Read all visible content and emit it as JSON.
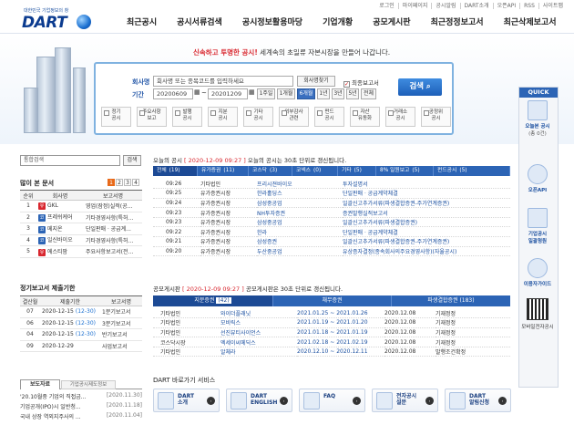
{
  "util": [
    "로그인",
    "마이페이지",
    "공시알림",
    "DART소개",
    "오픈API",
    "RSS",
    "사이트맵"
  ],
  "logo": {
    "sub": "대한민국 기업정보의 창",
    "word": "DART"
  },
  "gnb": [
    "최근공시",
    "공시서류검색",
    "공시정보활용마당",
    "기업개황",
    "공모게시판",
    "최근정정보고서",
    "최근삭제보고서"
  ],
  "hero": {
    "tag_bold": "신속하고 투명한 공시!",
    "tag_rest": " 세계속의 초일류 자본시장을 만들어 나갑니다."
  },
  "search": {
    "company_label": "회사명",
    "company_placeholder": "회사명 또는 종목코드를 입력하세요",
    "company_btn": "회사명찾기",
    "lastreport_label": "최종보고서",
    "period_label": "기간",
    "date_from": "20200609",
    "date_to": "20201209",
    "periods": [
      "1주일",
      "1개월",
      "6개월",
      "1년",
      "3년",
      "5년",
      "전체"
    ],
    "period_selected": "6개월",
    "search_btn": "검색",
    "categories": [
      [
        "정기",
        "공시"
      ],
      [
        "주요사항",
        "보고"
      ],
      [
        "발행",
        "공시"
      ],
      [
        "지분",
        "공시"
      ],
      [
        "기타",
        "공시"
      ],
      [
        "외부감사",
        "관련"
      ],
      [
        "펀드",
        "공시"
      ],
      [
        "자산",
        "유동화"
      ],
      [
        "거래소",
        "공시"
      ],
      [
        "공정위",
        "공시"
      ]
    ]
  },
  "quick": {
    "title": "QUICK",
    "items": [
      [
        "오늘본 공시",
        "(총 0건)"
      ],
      [
        "오픈API"
      ],
      [
        "기업공시",
        "일괄청원"
      ],
      [
        "이용자가이드"
      ],
      [
        "모바일전자공시"
      ]
    ]
  },
  "left": {
    "search_placeholder": "통합검색",
    "search_btn": "검색",
    "top_docs_title": "많이 본 문서",
    "pages": [
      "1",
      "2",
      "3",
      "4"
    ],
    "top_headers": [
      "순위",
      "회사명",
      "보고서명"
    ],
    "top_rows": [
      {
        "rank": "1",
        "badge": "유",
        "badge_color": "#d8262e",
        "company": "GKL",
        "report": "영업(잠정)실적(공..."
      },
      {
        "rank": "2",
        "badge": "코",
        "badge_color": "#2c64b5",
        "company": "프레쉬케어",
        "report": "기타경영사항(특허..."
      },
      {
        "rank": "3",
        "badge": "코",
        "badge_color": "#2c64b5",
        "company": "메지온",
        "report": "단일판매ㆍ공급계..."
      },
      {
        "rank": "4",
        "badge": "코",
        "badge_color": "#2c64b5",
        "company": "일신바이오",
        "report": "기타경영사항(특허..."
      },
      {
        "rank": "5",
        "badge": "유",
        "badge_color": "#d8262e",
        "company": "에스티팜",
        "report": "주요사항보고서(전..."
      }
    ],
    "period_title": "정기보고서 제출기한",
    "period_headers": [
      "결산월",
      "제출기한",
      "보고서명"
    ],
    "period_rows": [
      {
        "m": "07",
        "deadline": "2020-12-15",
        "tail": "(12-30)",
        "report": "1분기보고서"
      },
      {
        "m": "06",
        "deadline": "2020-12-15",
        "tail": "(12-30)",
        "report": "3분기보고서"
      },
      {
        "m": "04",
        "deadline": "2020-12-15",
        "tail": "(12-30)",
        "report": "반기보고서"
      },
      {
        "m": "09",
        "deadline": "2020-12-29",
        "tail": "",
        "report": "사업보고서"
      }
    ],
    "bottom_tabs": [
      "보도자료",
      "기업공시제도정보"
    ],
    "press": [
      {
        "t": "'20.10월중 기업의 직접금...",
        "d": "[2020.11.30]"
      },
      {
        "t": "기업공개(IPO)시 일반청...",
        "d": "[2020.11.18]"
      },
      {
        "t": "국내 상장 역외지주사의 ...",
        "d": "[2020.11.04]"
      }
    ]
  },
  "today": {
    "title_a": "오늘의 공시",
    "date": "[ 2020-12-09 09:27 ]",
    "title_b": "오늘의 공시는 30초 단위로 갱신됩니다.",
    "tabs": [
      {
        "label": "전체",
        "count": "(19)"
      },
      {
        "label": "유가증권",
        "count": "(11)"
      },
      {
        "label": "코스닥",
        "count": "(3)"
      },
      {
        "label": "코넥스",
        "count": "(0)"
      },
      {
        "label": "기타",
        "count": "(5)"
      },
      {
        "label": "8% 일원보고",
        "count": "(5)"
      },
      {
        "label": "펀드공시",
        "count": "(5)"
      }
    ],
    "rows": [
      {
        "time": "09:26",
        "market": "기타법인",
        "company": "프리시젼바이오",
        "report": "투자설명서"
      },
      {
        "time": "09:25",
        "market": "유가증권시장",
        "company": "한라홀딩스",
        "report": "단일판매ㆍ공급계약체결"
      },
      {
        "time": "09:24",
        "market": "유가증권시장",
        "company": "삼성중공업",
        "report": "일괄신고추가서류(파생결합증권-주가연계증권)"
      },
      {
        "time": "09:23",
        "market": "유가증권시장",
        "company": "NH투자증권",
        "report": "증권발행실적보고서"
      },
      {
        "time": "09:23",
        "market": "유가증권시장",
        "company": "삼성중공업",
        "report": "일괄신고추가서류(파생결합증권)"
      },
      {
        "time": "09:22",
        "market": "유가증권시장",
        "company": "한라",
        "report": "단일판매ㆍ공급계약체결"
      },
      {
        "time": "09:21",
        "market": "유가증권시장",
        "company": "삼성증권",
        "report": "일괄신고추가서류(파생결합증권-주가연계증권)"
      },
      {
        "time": "09:20",
        "market": "유가증권시장",
        "company": "두산중공업",
        "report": "유상증자결정(종속회사의주요경영사항)(자율공시)"
      }
    ]
  },
  "ipo": {
    "title_a": "공모게시판",
    "date": "[ 2020-12-09 09:27 ]",
    "title_b": "공모게시판은 30초 단위로 갱신됩니다.",
    "tab1": "지분증권",
    "tab1_count": "(42)",
    "tab2": "채무증권",
    "tab3": "파생결합증권",
    "tab3_count": "(183)",
    "rows": [
      {
        "market": "기타법인",
        "company": "와이더플래닛",
        "period": "2021.01.25 ~ 2021.01.26",
        "date": "2020.12.08",
        "type": "기재정정"
      },
      {
        "market": "기타법인",
        "company": "모비릭스",
        "period": "2021.01.19 ~ 2021.01.20",
        "date": "2020.12.08",
        "type": "기재정정"
      },
      {
        "market": "기타법인",
        "company": "선진뷰티사이언스",
        "period": "2021.01.18 ~ 2021.01.19",
        "date": "2020.12.08",
        "type": "기재정정"
      },
      {
        "market": "코스닥시장",
        "company": "엑세이씨메딕스",
        "period": "2021.02.18 ~ 2021.02.19",
        "date": "2020.12.08",
        "type": "기재정정"
      },
      {
        "market": "기타법인",
        "company": "알체라",
        "period": "2020.12.10 ~ 2020.12.11",
        "date": "2020.12.08",
        "type": "발행조건확정"
      }
    ]
  },
  "services": {
    "title": "DART 바로가기 서비스",
    "items": [
      [
        "DART",
        "소개"
      ],
      [
        "DART",
        "ENGLISH"
      ],
      [
        "FAQ"
      ],
      [
        "전자공시",
        "설문"
      ],
      [
        "DART",
        "알림신청"
      ]
    ]
  }
}
